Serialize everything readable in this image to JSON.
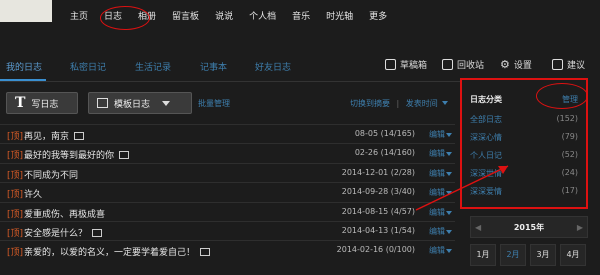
{
  "topnav": [
    "主页",
    "日志",
    "相册",
    "留言板",
    "说说",
    "个人档",
    "音乐",
    "时光轴",
    "更多"
  ],
  "tabs": [
    "我的日志",
    "私密日记",
    "生活记录",
    "记事本",
    "好友日志"
  ],
  "toolbar": {
    "drafts": "草稿箱",
    "recycle": "回收站",
    "settings": "设置",
    "feedback": "建议"
  },
  "buttons": {
    "write": "写日志",
    "template": "模板日志",
    "batch": "批量管理"
  },
  "sort": {
    "list_view": "切换到摘要",
    "sep": "|",
    "by_time": "发表时间"
  },
  "entries": [
    {
      "tag": "[顶]",
      "title": "再见，南京",
      "date": "08-05 (14/165)",
      "edit": "编辑"
    },
    {
      "tag": "[顶]",
      "title": "最好的我等到最好的你",
      "date": "02-26 (14/160)",
      "edit": "编辑"
    },
    {
      "tag": "[顶]",
      "title": "不同成为不同",
      "date": "2014-12-01 (2/28)",
      "edit": "编辑"
    },
    {
      "tag": "[顶]",
      "title": "许久",
      "date": "2014-09-28 (3/40)",
      "edit": "编辑"
    },
    {
      "tag": "[顶]",
      "title": "爱重成伤、再极成喜",
      "date": "2014-08-15 (4/57)",
      "edit": "编辑"
    },
    {
      "tag": "[顶]",
      "title": "安全感是什么？",
      "date": "2014-04-13 (1/54)",
      "edit": "编辑"
    },
    {
      "tag": "[顶]",
      "title": "亲爱的，以爱的名义，一定要学着爱自己！",
      "date": "2014-02-16 (0/100)",
      "edit": "编辑"
    }
  ],
  "sidebar": {
    "title": "日志分类",
    "manage": "管理",
    "categories": [
      {
        "label": "全部日志",
        "count": "(152)"
      },
      {
        "label": "深深心情",
        "count": "(79)"
      },
      {
        "label": "个人日记",
        "count": "(52)"
      },
      {
        "label": "深深世情",
        "count": "(24)"
      },
      {
        "label": "深深爱情",
        "count": "(17)"
      }
    ]
  },
  "calendar": {
    "prev": "◀",
    "year": "2015年",
    "next": "▶",
    "months": [
      "1月",
      "2月",
      "3月",
      "4月"
    ]
  },
  "colors": {
    "accent_link": "#3e7fae",
    "highlight_red": "#d11",
    "top_tag": "#d65b26"
  }
}
